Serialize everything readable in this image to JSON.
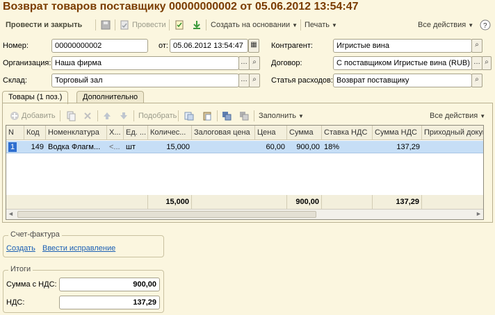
{
  "window": {
    "title": "Возврат товаров поставщику 00000000002 от 05.06.2012 13:54:47"
  },
  "toolbar": {
    "post_close": "Провести и закрыть",
    "post": "Провести",
    "create_based": "Создать на основании",
    "print": "Печать",
    "all_actions": "Все действия"
  },
  "form": {
    "number_label": "Номер:",
    "number_value": "00000000002",
    "date_label": "от:",
    "date_value": "05.06.2012 13:54:47",
    "counterparty_label": "Контрагент:",
    "counterparty_value": "Игристые вина",
    "organization_label": "Организация:",
    "organization_value": "Наша фирма",
    "contract_label": "Договор:",
    "contract_value": "С поставщиком Игристые вина (RUB)",
    "warehouse_label": "Склад:",
    "warehouse_value": "Торговый зал",
    "expense_label": "Статья расходов:",
    "expense_value": "Возврат поставщику"
  },
  "tabs": [
    {
      "label": "Товары (1 поз.)",
      "active": true
    },
    {
      "label": "Дополнительно",
      "active": false
    }
  ],
  "table_toolbar": {
    "add": "Добавить",
    "pick": "Подобрать",
    "fill": "Заполнить",
    "all_actions": "Все действия"
  },
  "table": {
    "headers": [
      "N",
      "Код",
      "Номенклатура",
      "Х...",
      "Ед. ...",
      "Количес...",
      "Залоговая цена",
      "Цена",
      "Сумма",
      "Ставка НДС",
      "Сумма НДС",
      "Приходный докум"
    ],
    "rows": [
      [
        "1",
        "149",
        "Водка Флагм...",
        "<...",
        "шт",
        "15,000",
        "",
        "60,00",
        "900,00",
        "18%",
        "137,29",
        ""
      ]
    ],
    "totals": {
      "quantity": "15,000",
      "sum": "900,00",
      "vat": "137,29"
    }
  },
  "invoice": {
    "title": "Счет-фактура",
    "create": "Создать",
    "correction": "Ввести исправление"
  },
  "totals": {
    "title": "Итоги",
    "sum_label": "Сумма с НДС:",
    "sum_value": "900,00",
    "vat_label": "НДС:",
    "vat_value": "137,29"
  },
  "colors": {
    "title": "#7A3C00",
    "background": "#FBF6DF",
    "selected_row": "#C6DEF6",
    "link": "#1A5FB4"
  }
}
